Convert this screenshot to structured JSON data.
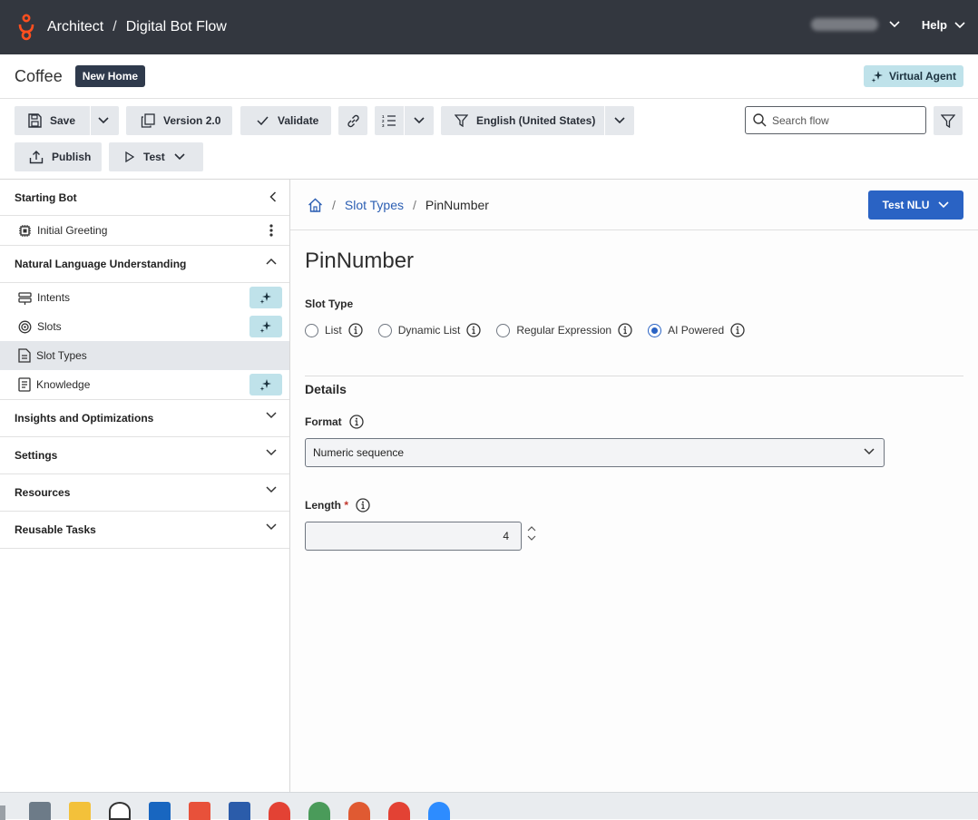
{
  "topbar": {
    "app": "Architect",
    "separator": "/",
    "flow_type": "Digital Bot Flow",
    "help_label": "Help"
  },
  "flow_header": {
    "name": "Coffee",
    "badge": "New Home",
    "virtual_agent_label": "Virtual Agent"
  },
  "toolbar": {
    "save_label": "Save",
    "version_label": "Version 2.0",
    "validate_label": "Validate",
    "language_label": "English (United States)",
    "publish_label": "Publish",
    "test_label": "Test",
    "search_placeholder": "Search flow"
  },
  "sidebar": {
    "starting_bot": "Starting Bot",
    "initial_greeting": "Initial Greeting",
    "nlu": "Natural Language Understanding",
    "items": [
      {
        "label": "Intents",
        "icon": "intents-icon",
        "ai": true
      },
      {
        "label": "Slots",
        "icon": "slots-icon",
        "ai": true
      },
      {
        "label": "Slot Types",
        "icon": "slot-types-icon",
        "ai": false,
        "selected": true
      },
      {
        "label": "Knowledge",
        "icon": "knowledge-icon",
        "ai": true
      }
    ],
    "insights": "Insights and Optimizations",
    "settings": "Settings",
    "resources": "Resources",
    "reusable_tasks": "Reusable Tasks"
  },
  "main": {
    "breadcrumb": {
      "separator": "/",
      "slot_types": "Slot Types",
      "current": "PinNumber"
    },
    "test_nlu_label": "Test NLU",
    "title": "PinNumber",
    "slot_type_label": "Slot Type",
    "slot_type_options": [
      {
        "label": "List",
        "selected": false
      },
      {
        "label": "Dynamic List",
        "selected": false
      },
      {
        "label": "Regular Expression",
        "selected": false
      },
      {
        "label": "AI Powered",
        "selected": true
      }
    ],
    "details_heading": "Details",
    "format_label": "Format",
    "format_value": "Numeric sequence",
    "length_label": "Length",
    "length_required_mark": "*",
    "length_value": "4"
  },
  "colors": {
    "topbar": "#33373f",
    "accent": "#2a63c4",
    "ai_chip": "#bfe2ea",
    "logo": "#ff4f1f"
  }
}
